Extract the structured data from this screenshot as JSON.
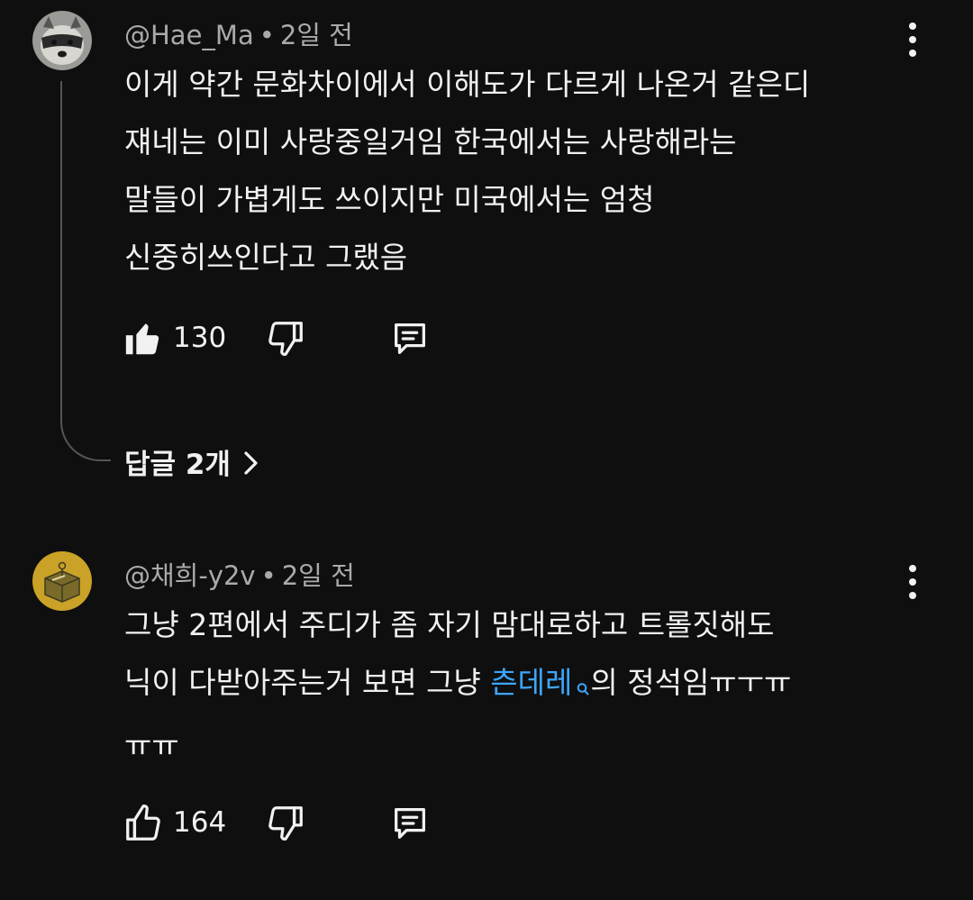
{
  "comments": [
    {
      "author": "@Hae_Ma",
      "separator": "•",
      "time": "2일 전",
      "avatar_icon": "raccoon-avatar",
      "lines": [
        "이게 약간 문화차이에서 이해도가 다르게 나온거 같은디",
        "쟤네는 이미 사랑중일거임 한국에서는 사랑해라는",
        "말들이 가볍게도 쓰이지만 미국에서는 엄청",
        "신중히쓰인다고 그랬음"
      ],
      "likes": "130",
      "liked": true,
      "replies_label": "답글 2개"
    },
    {
      "author": "@채희-y2v",
      "separator": "•",
      "time": "2일 전",
      "avatar_icon": "box-avatar",
      "line1": "그냥 2편에서 주디가 좀 자기 맘대로하고 트롤짓해도",
      "line2_prefix": "닉이 다받아주는거 보면 그냥 ",
      "line2_link": "츤데레",
      "line2_suffix": "의 정석임ㅠㅜㅠ",
      "line3": "ㅠㅠ",
      "likes": "164",
      "liked": false
    }
  ],
  "colors": {
    "background": "#0f0f0f",
    "text": "#f1f1f1",
    "secondary": "#aaaaaa",
    "link": "#3ea6ff"
  }
}
